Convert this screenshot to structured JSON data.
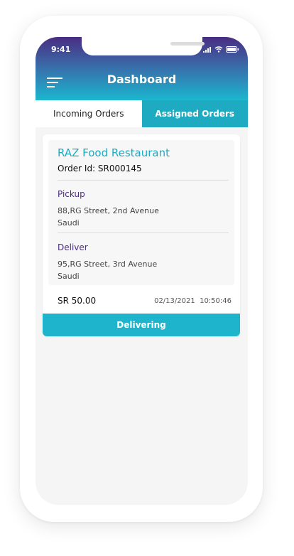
{
  "status_bar": {
    "time": "9:41"
  },
  "header": {
    "title": "Dashboard"
  },
  "tabs": [
    {
      "label": "Incoming Orders",
      "active": false
    },
    {
      "label": "Assigned Orders",
      "active": true
    }
  ],
  "order": {
    "restaurant": "RAZ Food Restaurant",
    "order_id": "Order Id: SR000145",
    "pickup": {
      "label": "Pickup",
      "line1": "88,RG Street, 2nd Avenue",
      "line2": "Saudi"
    },
    "deliver": {
      "label": "Deliver",
      "line1": "95,RG Street, 3rd Avenue",
      "line2": "Saudi"
    },
    "amount": "SR 50.00",
    "date": "02/13/2021",
    "time": "10:50:46",
    "action_label": "Delivering"
  },
  "colors": {
    "accent": "#1eabc2",
    "brand_purple": "#4b2d7f"
  },
  "icons": [
    "menu-icon",
    "signal-icon",
    "wifi-icon",
    "battery-icon"
  ]
}
